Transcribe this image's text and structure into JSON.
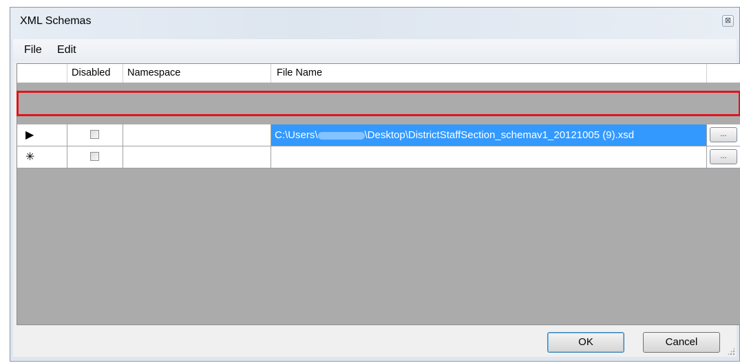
{
  "window": {
    "title": "XML Schemas",
    "close_glyph": "⊠"
  },
  "menu": {
    "items": [
      "File",
      "Edit"
    ]
  },
  "grid": {
    "columns": [
      "Disabled",
      "Namespace",
      "File Name"
    ],
    "rows": [
      {
        "marker": "▶",
        "disabled": false,
        "namespace": "",
        "file_prefix": "C:\\Users\\",
        "file_suffix": "\\Desktop\\DistrictStaffSection_schemav1_20121005 (9).xsd",
        "browse_label": "...",
        "selected": true
      },
      {
        "marker": "✳",
        "disabled": false,
        "namespace": "",
        "file_prefix": "",
        "file_suffix": "",
        "browse_label": "...",
        "selected": false
      }
    ]
  },
  "buttons": {
    "ok": "OK",
    "cancel": "Cancel"
  },
  "colors": {
    "selection": "#3399ff",
    "highlight_border": "#e1141b",
    "grid_background": "#ababab"
  }
}
